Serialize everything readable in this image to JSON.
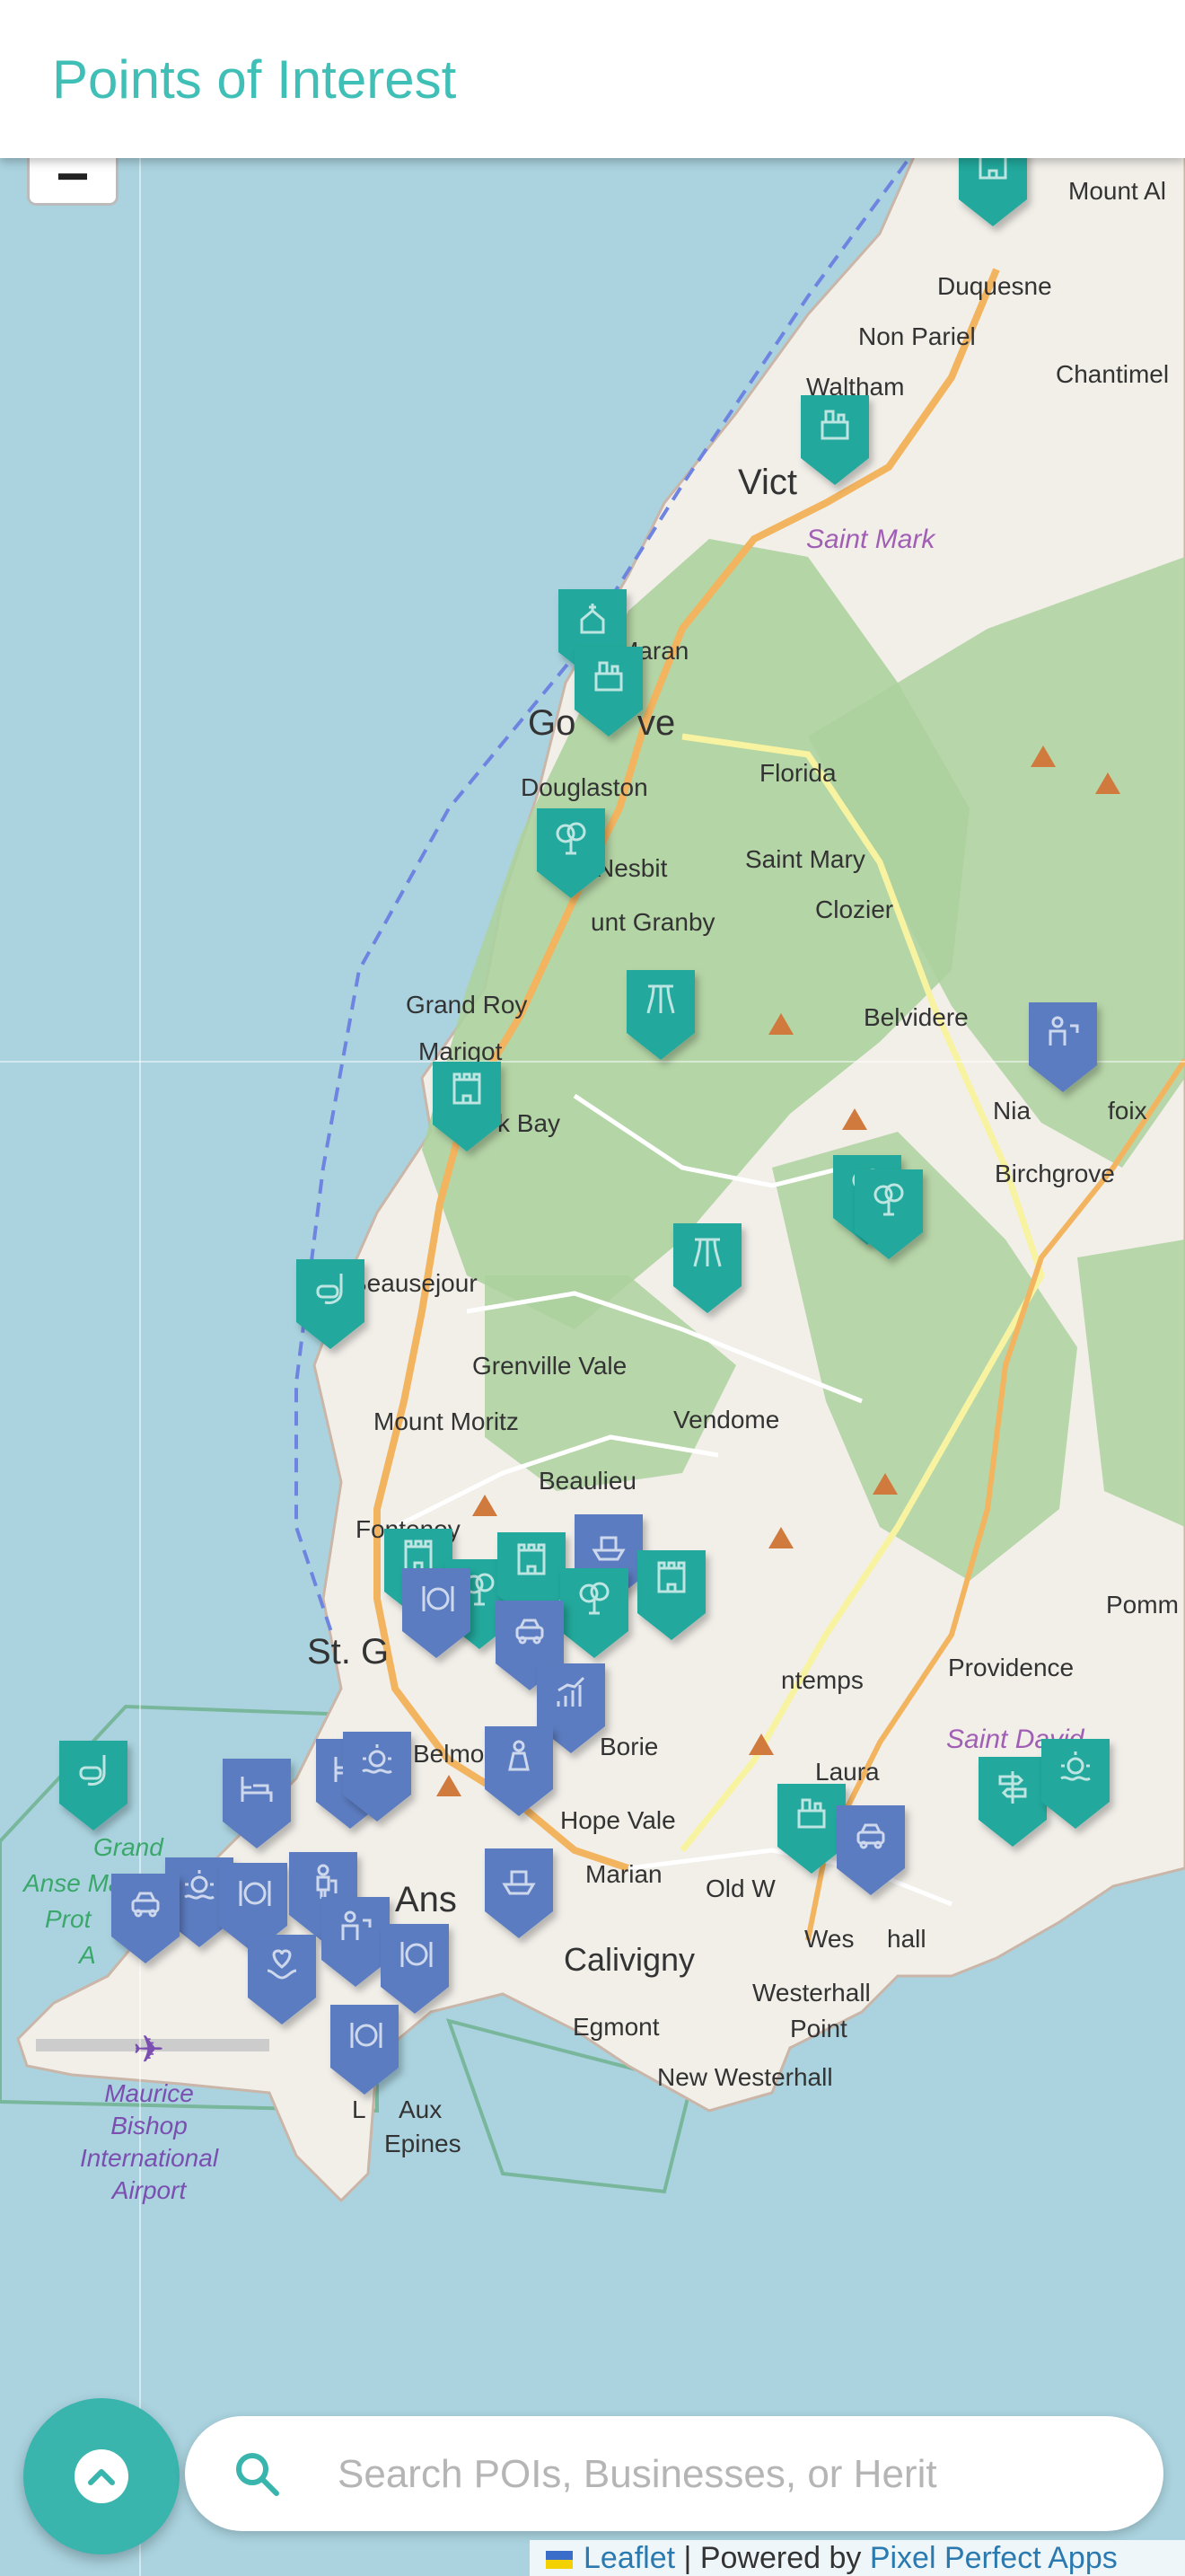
{
  "header": {
    "title": "Points of Interest"
  },
  "search": {
    "placeholder": "Search POIs, Businesses, or Herit"
  },
  "attribution": {
    "leaflet": "Leaflet",
    "separator": " | Powered by ",
    "provider": "Pixel Perfect Apps"
  },
  "colors": {
    "accent": "#3fbfb6",
    "heritage_marker": "#24a89c",
    "business_marker": "#5b7cc1",
    "water": "#aad3df",
    "land": "#f2efe9",
    "forest": "#add19e"
  },
  "map_labels": {
    "places": [
      "Mount Al",
      "Duquesne",
      "Non Pariel",
      "Waltham",
      "Chantimel",
      "Vict",
      "Maran",
      "Go",
      "ve",
      "Florida",
      "Douglaston",
      "Nesbit",
      "Saint Mary",
      "Clozier",
      "unt Granby",
      "Grand Roy",
      "Marigot",
      "k Bay",
      "Belvidere",
      "Nia",
      "foix",
      "Birchgrove",
      "Beausejour",
      "Grenville Vale",
      "Mount Moritz",
      "Vendome",
      "Beaulieu",
      "Fontenoy",
      "St. G",
      "Providence",
      "Pomm",
      "Belmont",
      "Borie",
      "ntemps",
      "Laura",
      "Hope Vale",
      "Marian",
      "Old W",
      "Ans",
      "Calivigny",
      "Wes",
      "hall",
      "Egmont",
      "Westerhall",
      "Point",
      "New Westerhall",
      "L",
      "Aux",
      "Epines",
      "Grand",
      "Anse Marine",
      "Prot",
      "A"
    ],
    "parishes": [
      "Saint Mark",
      "Saint David"
    ],
    "airport": [
      "Maurice",
      "Bishop",
      "International",
      "Airport"
    ]
  },
  "markers": [
    {
      "category": "heritage",
      "icon": "fort-icon"
    },
    {
      "category": "heritage",
      "icon": "estate-icon"
    },
    {
      "category": "heritage",
      "icon": "church-icon"
    },
    {
      "category": "heritage",
      "icon": "estate-icon"
    },
    {
      "category": "heritage",
      "icon": "tree-icon"
    },
    {
      "category": "heritage",
      "icon": "waterfall-icon"
    },
    {
      "category": "heritage",
      "icon": "fort-icon"
    },
    {
      "category": "heritage",
      "icon": "tree-icon"
    },
    {
      "category": "heritage",
      "icon": "tree-icon"
    },
    {
      "category": "heritage",
      "icon": "waterfall-icon"
    },
    {
      "category": "heritage",
      "icon": "snorkel-icon"
    },
    {
      "category": "business",
      "icon": "tour-guide-icon"
    },
    {
      "category": "heritage",
      "icon": "fort-icon"
    },
    {
      "category": "heritage",
      "icon": "tree-icon"
    },
    {
      "category": "business",
      "icon": "tour-boat-icon"
    },
    {
      "category": "heritage",
      "icon": "fort-icon"
    },
    {
      "category": "heritage",
      "icon": "fort-icon"
    },
    {
      "category": "heritage",
      "icon": "tree-icon"
    },
    {
      "category": "business",
      "icon": "taxi-icon"
    },
    {
      "category": "business",
      "icon": "restaurant-icon"
    },
    {
      "category": "business",
      "icon": "chart-icon"
    },
    {
      "category": "business",
      "icon": "shopping-icon"
    },
    {
      "category": "business",
      "icon": "boat-icon"
    },
    {
      "category": "heritage",
      "icon": "snorkel-icon"
    },
    {
      "category": "business",
      "icon": "hotel-icon"
    },
    {
      "category": "business",
      "icon": "hotel-icon"
    },
    {
      "category": "business",
      "icon": "beach-icon"
    },
    {
      "category": "business",
      "icon": "beach-icon"
    },
    {
      "category": "business",
      "icon": "taxi-icon"
    },
    {
      "category": "business",
      "icon": "restaurant-icon"
    },
    {
      "category": "business",
      "icon": "traveller-icon"
    },
    {
      "category": "business",
      "icon": "care-icon"
    },
    {
      "category": "business",
      "icon": "tour-guide-icon"
    },
    {
      "category": "business",
      "icon": "restaurant-icon"
    },
    {
      "category": "business",
      "icon": "restaurant-icon"
    },
    {
      "category": "heritage",
      "icon": "estate-icon"
    },
    {
      "category": "business",
      "icon": "taxi-icon"
    },
    {
      "category": "heritage",
      "icon": "signpost-icon"
    },
    {
      "category": "heritage",
      "icon": "beach-icon"
    }
  ]
}
